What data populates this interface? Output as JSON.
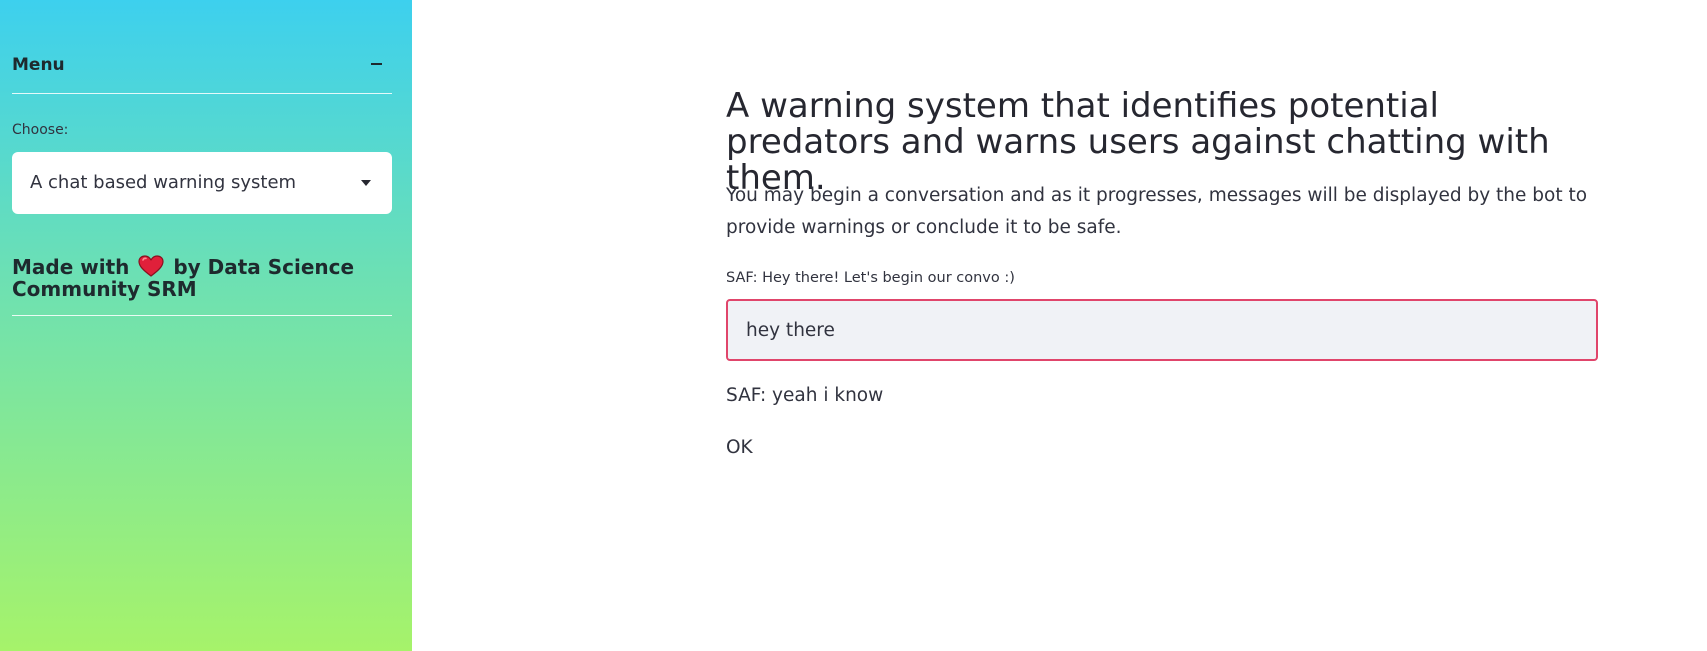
{
  "sidebar": {
    "menu_title": "Menu",
    "collapse_icon": "minus-icon",
    "choose_label": "Choose:",
    "select": {
      "selected": "A chat based warning system",
      "icon": "caret-down-icon"
    },
    "made_with_prefix": "Made with",
    "made_with_icon": "heart-icon",
    "made_with_suffix": "by Data Science Community SRM",
    "gradient_colors": [
      "#3dd0ee",
      "#6fe1b0",
      "#a6f36a"
    ]
  },
  "main": {
    "title": "A warning system that identifies potential predators and warns users against chatting with them.",
    "description": "You may begin a conversation and as it progresses, messages will be displayed by the bot to provide warnings or conclude it to be safe.",
    "input_label": "SAF: Hey there! Let's begin our convo :)",
    "input_value": "hey there",
    "bot_message": "SAF: yeah i know",
    "status": "OK",
    "input_border_color": "#e0456b"
  }
}
